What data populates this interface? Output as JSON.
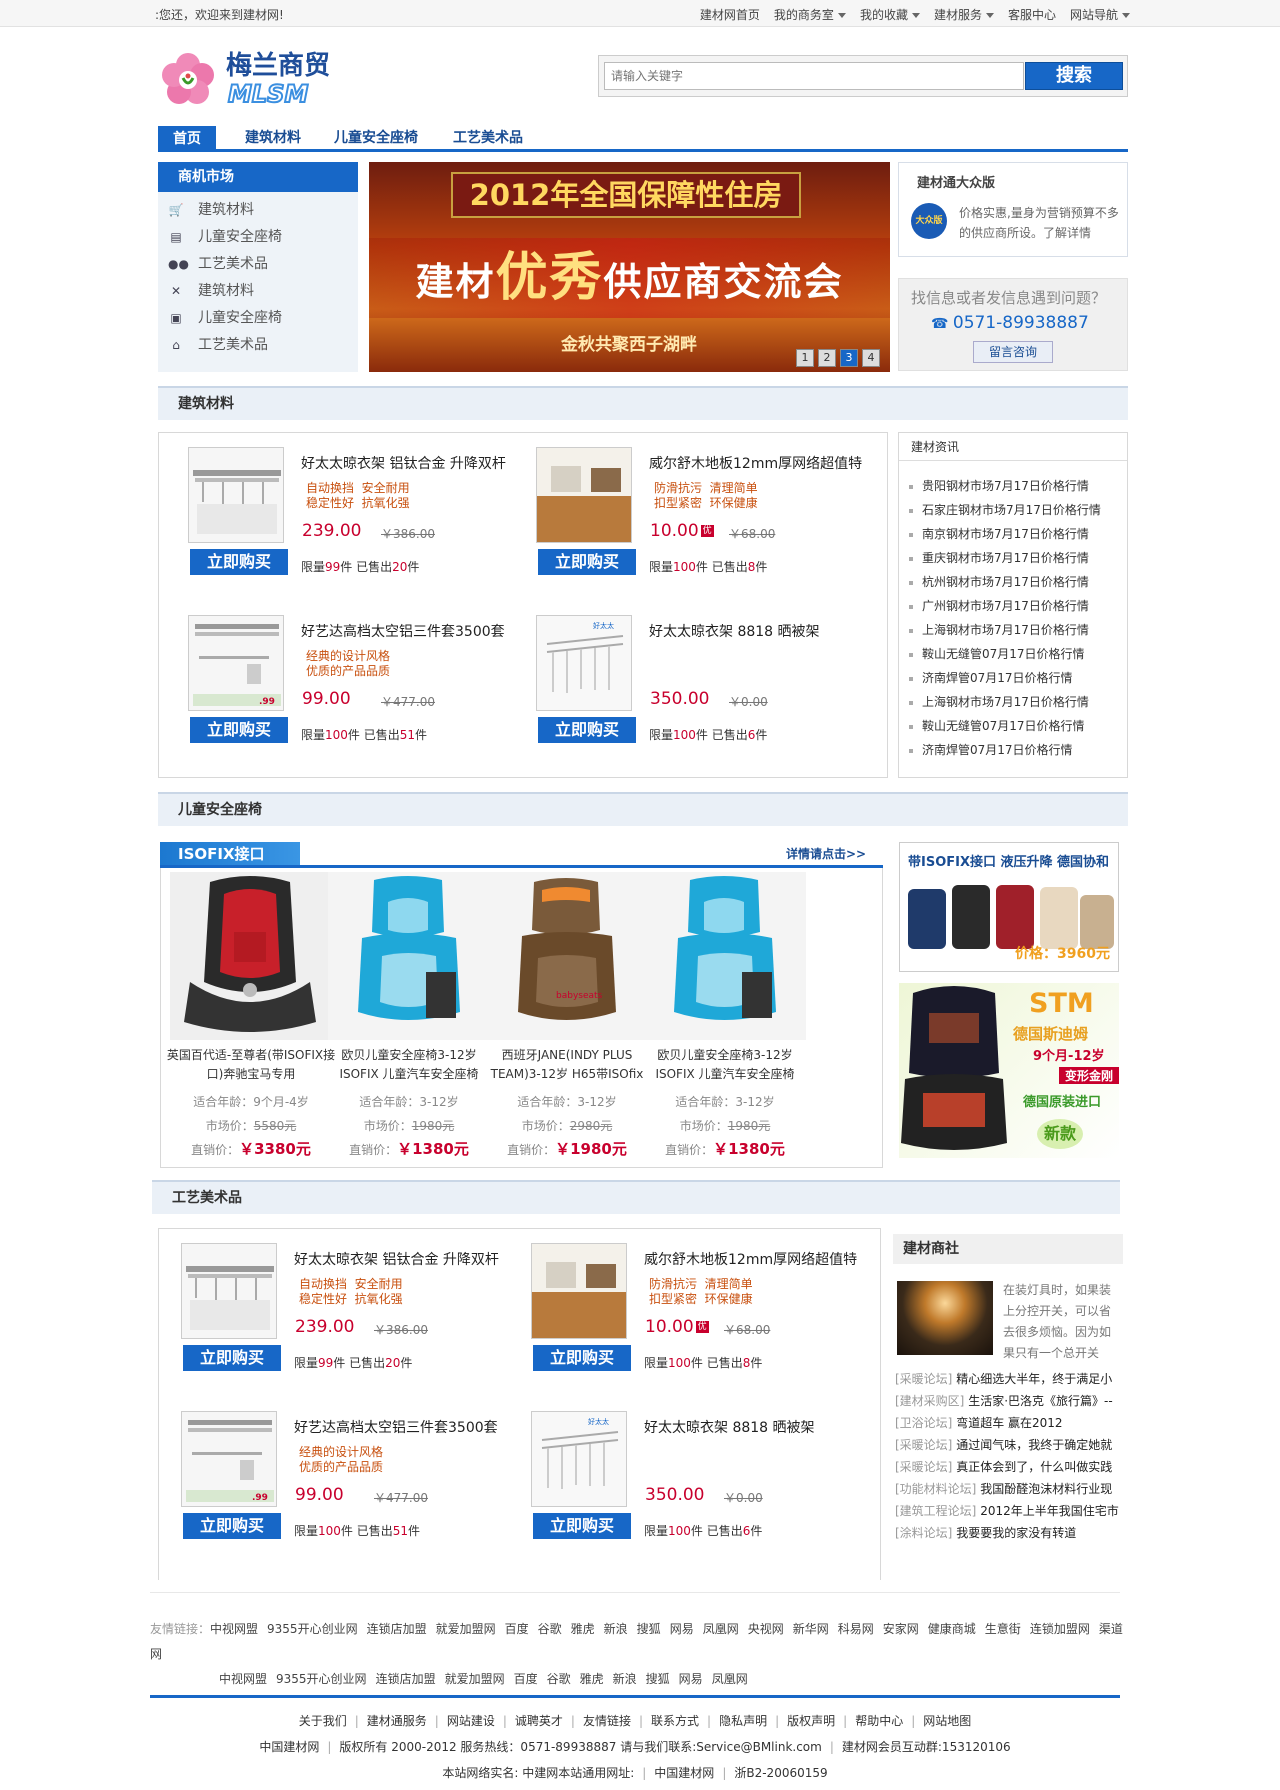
{
  "topbar": {
    "welcome": ":您还，欢迎来到建材网!",
    "links": [
      "建材网首页",
      "我的商务室",
      "我的收藏",
      "建材服务",
      "客服中心",
      "网站导航"
    ]
  },
  "logo": {
    "cn": "梅兰商贸",
    "en": "MLSM"
  },
  "search": {
    "placeholder": "请输入关键字",
    "button": "搜索"
  },
  "nav": [
    "首页",
    "建筑材料",
    "儿童安全座椅",
    "工艺美术品"
  ],
  "market": {
    "title": "商机市场",
    "items": [
      {
        "icon": "cart-icon",
        "label": "建筑材料"
      },
      {
        "icon": "printer-icon",
        "label": "儿童安全座椅"
      },
      {
        "icon": "users-icon",
        "label": "工艺美术品"
      },
      {
        "icon": "tools-icon",
        "label": "建筑材料"
      },
      {
        "icon": "blogger-icon",
        "label": "儿童安全座椅"
      },
      {
        "icon": "bank-icon",
        "label": "工艺美术品"
      }
    ]
  },
  "banner": {
    "line1": "2012年全国保障性住房",
    "line2a": "建材",
    "line2b": "优秀",
    "line2c": "供应商交流会",
    "line3": "金秋共聚西子湖畔",
    "pages": [
      "1",
      "2",
      "3",
      "4"
    ],
    "active_page": "3"
  },
  "promo": {
    "title": "建材通大众版",
    "badge": "大众版",
    "text": "价格实惠,量身为营销预算不多的供应商所设。了解详情"
  },
  "help": {
    "question": "找信息或者发信息遇到问题？",
    "phone": "0571-89938887",
    "button": "留言咨询"
  },
  "sections": {
    "building": "建筑材料",
    "seats": "儿童安全座椅",
    "crafts": "工艺美术品"
  },
  "products": [
    {
      "name": "好太太晾衣架  铝钛合金  升降双杆",
      "features": "自动换挡  安全耐用\n稳定性好  抗氧化强",
      "price": "239.00",
      "old_price": "￥386.00",
      "hot": false,
      "buy": "立即购买",
      "limit_pre": "限量",
      "limit": "99",
      "limit_mid": "件  已售出",
      "sold": "20",
      "limit_post": "件"
    },
    {
      "name": "威尔舒木地板12mm厚网络超值特",
      "features": "防滑抗污  清理简单\n扣型紧密  环保健康",
      "price": "10.00",
      "old_price": "￥68.00",
      "hot": true,
      "hot_label": "优",
      "buy": "立即购买",
      "limit_pre": "限量",
      "limit": "100",
      "limit_mid": "件  已售出",
      "sold": "8",
      "limit_post": "件"
    },
    {
      "name": "好艺达高档太空铝三件套3500套",
      "features": "经典的设计风格\n优质的产品品质",
      "price": "99.00",
      "old_price": "￥477.00",
      "hot": false,
      "buy": "立即购买",
      "limit_pre": "限量",
      "limit": "100",
      "limit_mid": "件  已售出",
      "sold": "51",
      "limit_post": "件"
    },
    {
      "name": "好太太晾衣架  8818  晒被架",
      "features": "",
      "price": "350.00",
      "old_price": "￥0.00",
      "hot": false,
      "buy": "立即购买",
      "limit_pre": "限量",
      "limit": "100",
      "limit_mid": "件  已售出",
      "sold": "6",
      "limit_post": "件"
    }
  ],
  "news": {
    "title": "建材资讯",
    "items": [
      "贵阳钢材市场7月17日价格行情",
      "石家庄钢材市场7月17日价格行情",
      "南京钢材市场7月17日价格行情",
      "重庆钢材市场7月17日价格行情",
      "杭州钢材市场7月17日价格行情",
      "广州钢材市场7月17日价格行情",
      "上海钢材市场7月17日价格行情",
      "鞍山无缝管07月17日价格行情",
      "济南焊管07月17日价格行情",
      "上海钢材市场7月17日价格行情",
      "鞍山无缝管07月17日价格行情",
      "济南焊管07月17日价格行情"
    ]
  },
  "isofix": {
    "tab": "ISOFIX接口",
    "more": "详情请点击>>"
  },
  "seats": [
    {
      "name": "英国百代适-至尊者(带ISOFIX接口)奔驰宝马专用",
      "age": "适合年龄：9个月-4岁",
      "mkt_label": "市场价：",
      "mkt": "5580元",
      "dp_label": "直销价：",
      "dp": "￥3380元",
      "color": "#c8202a"
    },
    {
      "name": "欧贝儿童安全座椅3-12岁ISOFIX 儿童汽车安全座椅",
      "age": "适合年龄：3-12岁",
      "mkt_label": "市场价：",
      "mkt": "1980元",
      "dp_label": "直销价：",
      "dp": "￥1380元",
      "color": "#1fa8d8"
    },
    {
      "name": "西班牙JANE(INDY PLUS TEAM)3-12岁 H65带ISOfix",
      "age": "适合年龄：3-12岁",
      "mkt_label": "市场价：",
      "mkt": "2980元",
      "dp_label": "直销价：",
      "dp": "￥1980元",
      "color": "#7a5a3a"
    },
    {
      "name": "欧贝儿童安全座椅3-12岁ISOFIX 儿童汽车安全座椅",
      "age": "适合年龄：3-12岁",
      "mkt_label": "市场价：",
      "mkt": "1980元",
      "dp_label": "直销价：",
      "dp": "￥1380元",
      "color": "#1fa8d8"
    }
  ],
  "ads": {
    "ad1_title": "带ISOFIX接口 液压升降 德国协和",
    "ad1_price": "价格：3960元",
    "ad2_brand": "STM",
    "ad2_l1": "德国斯迪姆",
    "ad2_l2": "9个月-12岁",
    "ad2_l3": "变形金刚",
    "ad2_l4": "德国原装进口",
    "ad2_l5": "新款"
  },
  "shop": {
    "title": "建材商社",
    "intro": "在装灯具时，如果装上分控开关，可以省去很多烦恼。因为如果只有一个总开关",
    "items": [
      {
        "cat": "[采暖论坛]",
        "text": "精心细选大半年，终于满足小"
      },
      {
        "cat": "[建材采购区]",
        "text": "生活家·巴洛克《旅行篇》--"
      },
      {
        "cat": "[卫浴论坛]",
        "text": "弯道超车 赢在2012"
      },
      {
        "cat": "[采暖论坛]",
        "text": "通过闻气味，我终于确定她就"
      },
      {
        "cat": "[采暖论坛]",
        "text": "真正体会到了，什么叫做实践"
      },
      {
        "cat": "[功能材料论坛]",
        "text": "我国酚醛泡沫材料行业现"
      },
      {
        "cat": "[建筑工程论坛]",
        "text": "2012年上半年我国住宅市"
      },
      {
        "cat": "[涂料论坛]",
        "text": "我要要我的家没有转道"
      }
    ]
  },
  "friend": {
    "label": "友情链接：",
    "row1": [
      "中视网盟",
      "9355开心创业网",
      "连锁店加盟",
      "就爱加盟网",
      "百度",
      "谷歌",
      "雅虎",
      "新浪",
      "搜狐",
      "网易",
      "凤凰网",
      "央视网",
      "新华网",
      "科易网",
      "安家网",
      "健康商城",
      "生意街",
      "连锁加盟网",
      "渠道网"
    ],
    "row2": [
      "中视网盟",
      "9355开心创业网",
      "连锁店加盟",
      "就爱加盟网",
      "百度",
      "谷歌",
      "雅虎",
      "新浪",
      "搜狐",
      "网易",
      "凤凰网"
    ]
  },
  "footer": {
    "links": [
      "关于我们",
      "建材通服务",
      "网站建设",
      "诚聘英才",
      "友情链接",
      "联系方式",
      "隐私声明",
      "版权声明",
      "帮助中心",
      "网站地图"
    ],
    "line2": [
      "中国建材网",
      "版权所有 2000-2012 服务热线：0571-89938887 请与我们联系:Service@BMlink.com",
      "建材网会员互动群:153120106"
    ],
    "line3": [
      "本站网络实名: 中建网本站通用网址:",
      "中国建材网",
      "浙B2-20060159"
    ]
  },
  "colors": {
    "brand_blue": "#1767c7",
    "price_red": "#c8002d",
    "feature_orange": "#c8500f"
  }
}
